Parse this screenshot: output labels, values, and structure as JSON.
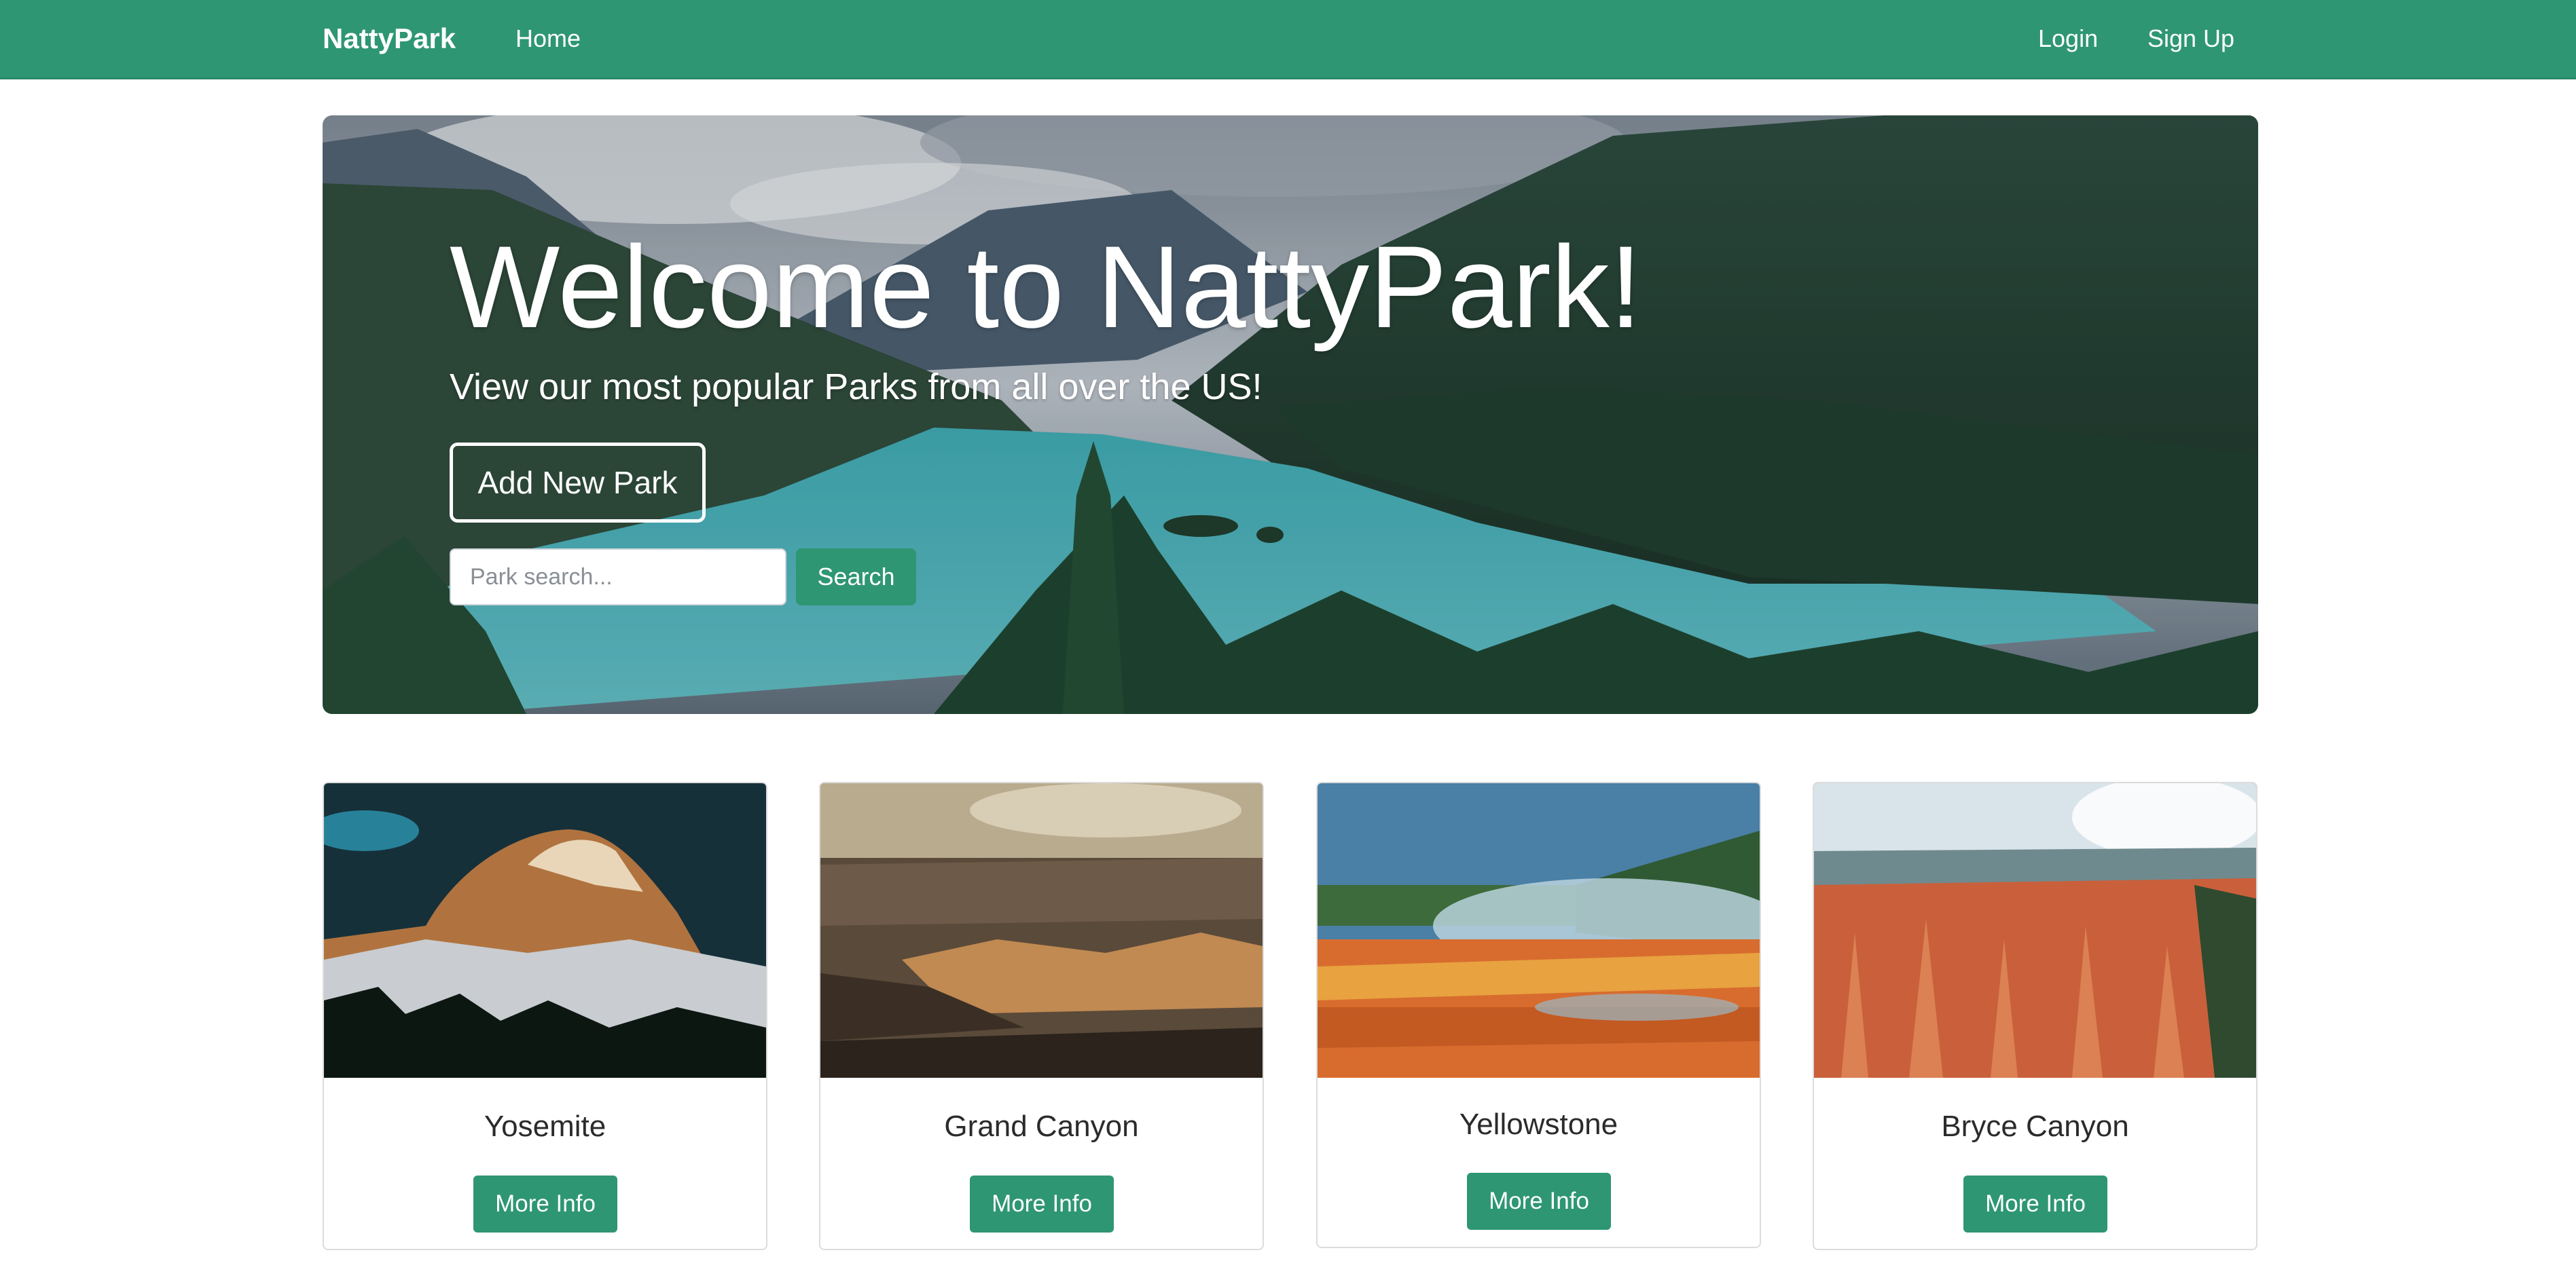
{
  "navbar": {
    "brand": "NattyPark",
    "links": {
      "home": "Home",
      "login": "Login",
      "signup": "Sign Up"
    }
  },
  "hero": {
    "title": "Welcome to NattyPark!",
    "subtitle": "View our most popular Parks from all over the US!",
    "add_button": "Add New Park",
    "search": {
      "placeholder": "Park search...",
      "value": "",
      "button": "Search"
    }
  },
  "parks": [
    {
      "name": "Yosemite",
      "button": "More Info"
    },
    {
      "name": "Grand Canyon",
      "button": "More Info"
    },
    {
      "name": "Yellowstone",
      "button": "More Info"
    },
    {
      "name": "Bryce Canyon",
      "button": "More Info"
    }
  ],
  "colors": {
    "brand_green": "#2e9673",
    "white": "#ffffff",
    "card_border": "#dcdcdc"
  }
}
